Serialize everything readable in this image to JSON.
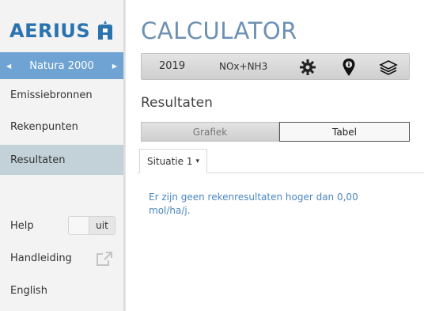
{
  "app": {
    "logo_text": "AERIUS",
    "title": "CALCULATOR"
  },
  "sidebar": {
    "nature_selector": {
      "label": "Natura 2000",
      "prev_icon": "triangle-left",
      "next_icon": "triangle-right"
    },
    "items": [
      {
        "label": "Emissiebronnen",
        "active": false
      },
      {
        "label": "Rekenpunten",
        "active": false
      },
      {
        "label": "Resultaten",
        "active": true
      }
    ],
    "help": {
      "label": "Help",
      "toggle_state": "uit"
    },
    "manual": {
      "label": "Handleiding",
      "icon": "external-link-icon"
    },
    "language": {
      "label": "English"
    }
  },
  "toolbar": {
    "year": "2019",
    "substance": "NOx+NH3",
    "icons": [
      "gear-icon",
      "map-marker-info-icon",
      "layers-icon"
    ]
  },
  "main": {
    "section_title": "Resultaten",
    "view_options": [
      {
        "label": "Grafiek",
        "selected": false
      },
      {
        "label": "Tabel",
        "selected": true
      }
    ],
    "tab": {
      "label": "Situatie 1",
      "caret": "▾"
    },
    "message": "Er zijn geen rekenresultaten hoger dan 0,00 mol/ha/j."
  },
  "colors": {
    "brand_blue": "#2a73ae",
    "title_blue": "#6d90b3",
    "nature_bar": "#6fa3d3",
    "active_nav": "#c3d1d9",
    "message_text": "#4a87bf"
  }
}
